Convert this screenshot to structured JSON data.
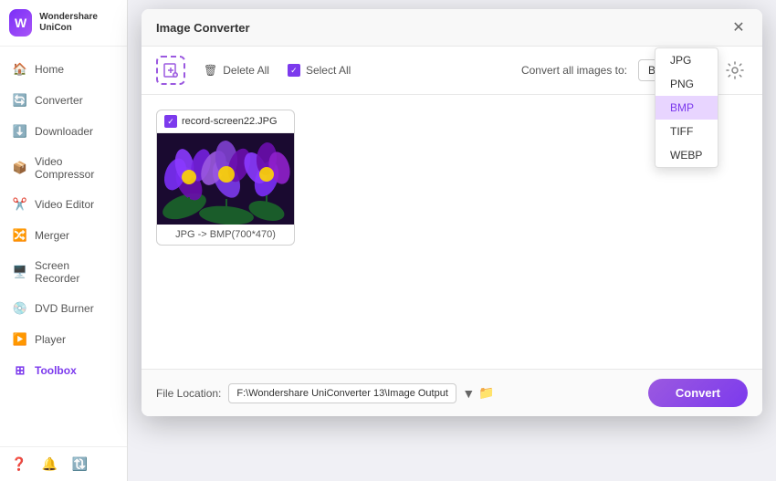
{
  "app": {
    "name": "Wondershare UniCon",
    "logo_letter": "W"
  },
  "sidebar": {
    "items": [
      {
        "id": "home",
        "label": "Home",
        "icon": "🏠"
      },
      {
        "id": "converter",
        "label": "Converter",
        "icon": "🔄"
      },
      {
        "id": "downloader",
        "label": "Downloader",
        "icon": "⬇️"
      },
      {
        "id": "video-compressor",
        "label": "Video Compressor",
        "icon": "📦"
      },
      {
        "id": "video-editor",
        "label": "Video Editor",
        "icon": "✂️"
      },
      {
        "id": "merger",
        "label": "Merger",
        "icon": "🔀"
      },
      {
        "id": "screen-recorder",
        "label": "Screen Recorder",
        "icon": "🖥️"
      },
      {
        "id": "dvd-burner",
        "label": "DVD Burner",
        "icon": "💿"
      },
      {
        "id": "player",
        "label": "Player",
        "icon": "▶️"
      },
      {
        "id": "toolbox",
        "label": "Toolbox",
        "icon": "⊞"
      }
    ],
    "active": "toolbox"
  },
  "dialog": {
    "title": "Image Converter",
    "toolbar": {
      "delete_label": "Delete All",
      "select_all_label": "Select All",
      "convert_all_label": "Convert all images to:",
      "format_options": [
        "JPG",
        "PNG",
        "BMP",
        "TIFF",
        "WEBP"
      ],
      "selected_format": "BMP"
    },
    "files": [
      {
        "name": "record-screen22.JPG",
        "conversion": "JPG -> BMP(700*470)"
      }
    ],
    "dropdown_open": true,
    "dropdown_items": [
      {
        "label": "JPG",
        "selected": false
      },
      {
        "label": "PNG",
        "selected": false
      },
      {
        "label": "BMP",
        "selected": true
      },
      {
        "label": "TIFF",
        "selected": false
      },
      {
        "label": "WEBP",
        "selected": false
      }
    ],
    "footer": {
      "file_location_label": "File Location:",
      "file_location_value": "F:\\Wondershare UniConverter 13\\Image Output",
      "convert_button": "Convert"
    }
  }
}
